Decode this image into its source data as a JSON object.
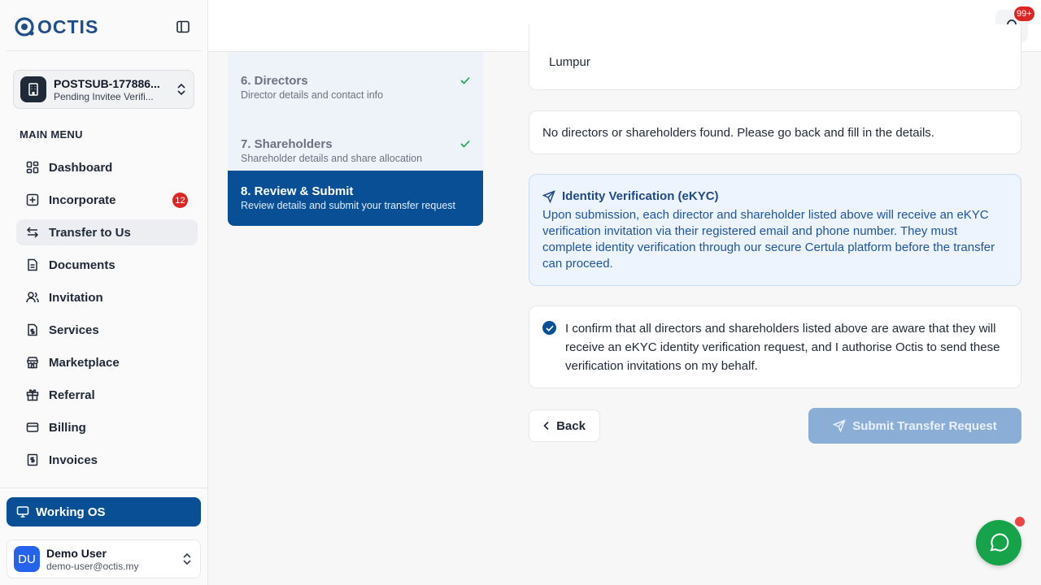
{
  "brand": {
    "name": "OCTIS",
    "accent": "#084f96"
  },
  "company": {
    "name": "POSTSUB-177886...",
    "status": "Pending Invitee Verifi..."
  },
  "menu": {
    "label": "MAIN MENU",
    "items": [
      {
        "label": "Dashboard",
        "icon": "dashboard-icon"
      },
      {
        "label": "Incorporate",
        "icon": "plus-square-icon",
        "badge": "12"
      },
      {
        "label": "Transfer to Us",
        "icon": "transfer-icon",
        "active": true
      },
      {
        "label": "Documents",
        "icon": "document-icon"
      },
      {
        "label": "Invitation",
        "icon": "users-icon"
      },
      {
        "label": "Services",
        "icon": "file-dollar-icon"
      },
      {
        "label": "Marketplace",
        "icon": "store-icon"
      },
      {
        "label": "Referral",
        "icon": "gift-icon"
      },
      {
        "label": "Billing",
        "icon": "credit-card-icon"
      },
      {
        "label": "Invoices",
        "icon": "receipt-icon"
      }
    ]
  },
  "working_os": {
    "label": "Working OS"
  },
  "user": {
    "initials": "DU",
    "name": "Demo User",
    "email": "demo-user@octis.my"
  },
  "notifications": {
    "count": "99+"
  },
  "steps": [
    {
      "title": "6. Directors",
      "subtitle": "Director details and contact info",
      "done": true
    },
    {
      "title": "7. Shareholders",
      "subtitle": "Shareholder details and share allocation",
      "done": true
    },
    {
      "title": "8. Review & Submit",
      "subtitle": "Review details and submit your transfer request",
      "active": true
    }
  ],
  "review": {
    "address_tail": "Lumpur",
    "empty_message": "No directors or shareholders found. Please go back and fill in the details.",
    "ekyc": {
      "title": "Identity Verification (eKYC)",
      "body": "Upon submission, each director and shareholder listed above will receive an eKYC verification invitation via their registered email and phone number. They must complete identity verification through our secure Certula platform before the transfer can proceed."
    },
    "confirm": {
      "checked": true,
      "text": "I confirm that all directors and shareholders listed above are aware that they will receive an eKYC identity verification request, and I authorise Octis to send these verification invitations on my behalf."
    }
  },
  "actions": {
    "back": "Back",
    "submit": "Submit Transfer Request"
  }
}
